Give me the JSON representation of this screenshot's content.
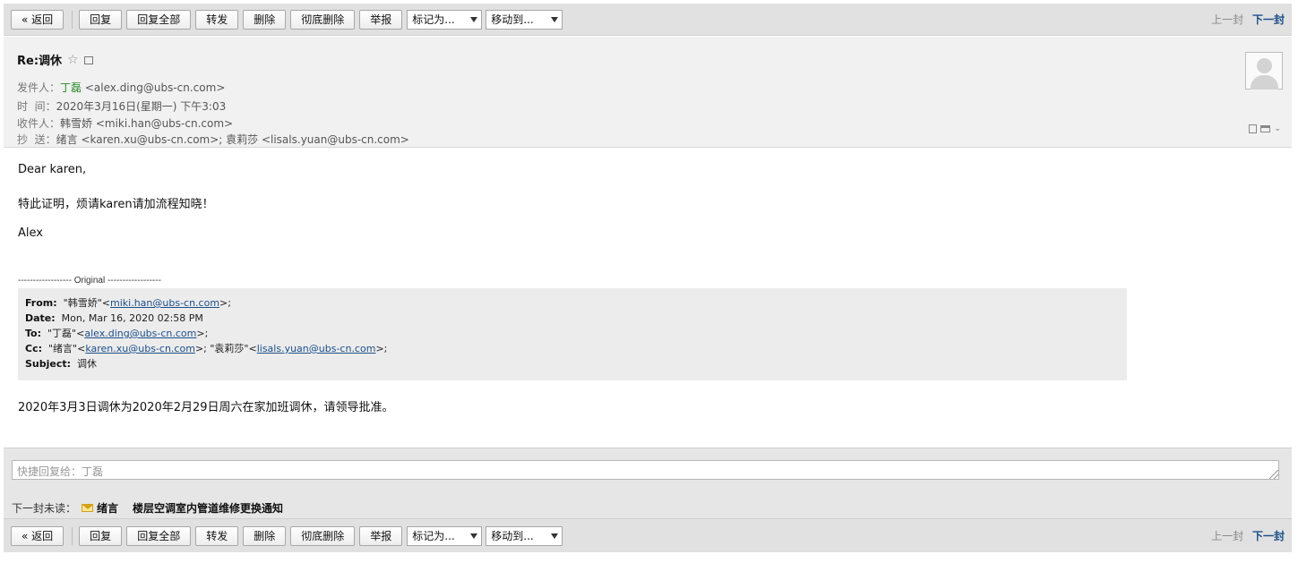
{
  "toolbar": {
    "back": "« 返回",
    "reply": "回复",
    "reply_all": "回复全部",
    "forward": "转发",
    "delete": "删除",
    "delete_permanent": "彻底删除",
    "report": "举报",
    "mark_as": "标记为...",
    "move_to": "移动到...",
    "prev": "上一封",
    "next": "下一封"
  },
  "email": {
    "subject": "Re:调休",
    "star": "☆",
    "sender_label": "发件人：",
    "sender_name": "丁磊",
    "sender_email": "<alex.ding@ubs-cn.com>",
    "time_label": "时  间：",
    "time_value": "2020年3月16日(星期一) 下午3:03",
    "to_label": "收件人：",
    "to_value": "韩雪娇 <miki.han@ubs-cn.com>",
    "cc_label": "抄  送：",
    "cc_value": "绪言 <karen.xu@ubs-cn.com>; 袁莉莎 <lisals.yuan@ubs-cn.com>"
  },
  "body": {
    "greeting": "Dear karen,",
    "line1": "特此证明，烦请karen请加流程知晓！",
    "signature": "Alex",
    "original_divider": "------------------ Original ------------------",
    "quote": {
      "from_label": "From:",
      "from_name": "\"韩雪娇\"<",
      "from_email": "miki.han@ubs-cn.com",
      "from_tail": ">;",
      "date_label": "Date:",
      "date_value": "Mon, Mar 16, 2020 02:58 PM",
      "to_label": "To:",
      "to_name": "\"丁磊\"<",
      "to_email": "alex.ding@ubs-cn.com",
      "to_tail": ">;",
      "cc_label": "Cc:",
      "cc_name1": "\"绪言\"<",
      "cc_email1": "karen.xu@ubs-cn.com",
      "cc_mid": ">; \"袁莉莎\"<",
      "cc_email2": "lisals.yuan@ubs-cn.com",
      "cc_tail": ">;",
      "subject_label": "Subject:",
      "subject_value": "调休"
    },
    "original_message": "2020年3月3日调休为2020年2月29日周六在家加班调休，请领导批准。"
  },
  "quick_reply": {
    "placeholder": "快捷回复给：丁磊"
  },
  "next_unread": {
    "label": "下一封未读：",
    "from": "绪言",
    "subject": "楼层空调室内管道维修更换通知"
  }
}
